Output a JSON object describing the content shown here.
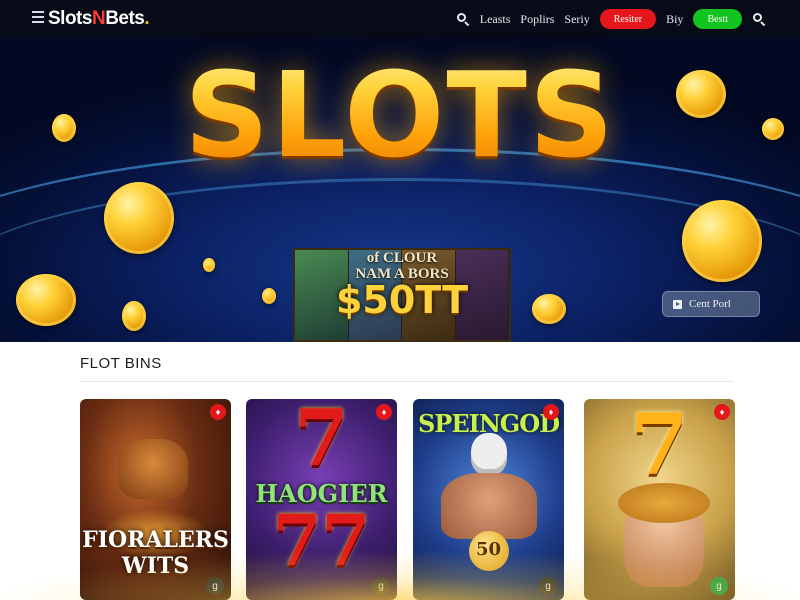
{
  "header": {
    "logo_main": "Slots",
    "logo_n": "N",
    "logo_end": "Bets",
    "logo_dot": ".",
    "nav": [
      "Leasts",
      "Poplirs",
      "Seriy"
    ],
    "register_label": "Resiter",
    "buy_label": "Biy",
    "login_label": "Bestt"
  },
  "hero": {
    "title": "SLOTS",
    "banner_line1": "of CLOUR",
    "banner_line2": "NAM A BORS",
    "banner_amount": "$50TT",
    "cta_label": "Cent Porl"
  },
  "section": {
    "title": "FLOT BINS"
  },
  "games": [
    {
      "name_line1": "FIORALERS",
      "name_line2": "WITS",
      "hot": "♦",
      "play": "g"
    },
    {
      "name": "HAOGIER",
      "seven_top": "7",
      "seven_bottom": "77",
      "hot": "♦",
      "play": "g"
    },
    {
      "name": "SPEINGOD",
      "value": "50",
      "hot": "♦",
      "play": "g"
    },
    {
      "seven": "7",
      "hot": "♦",
      "play": "g"
    }
  ],
  "colors": {
    "nav_bg": "#070b17",
    "register_red": "#e5161c",
    "login_green": "#11c41f",
    "gold": "#ffc21a"
  }
}
